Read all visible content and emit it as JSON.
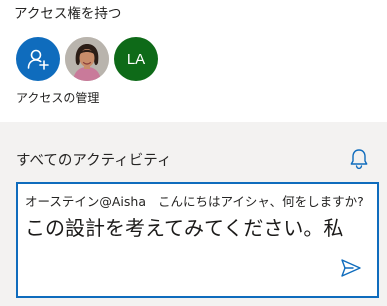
{
  "access": {
    "title": "アクセス権を持つ",
    "add_icon": "add-person-icon",
    "avatar_initials": "LA",
    "manage_label": "アクセスの管理"
  },
  "activity": {
    "title": "すべてのアクティビティ",
    "bell_icon": "bell-icon",
    "comment": {
      "mention_prefix": "オーステイン@Aisha",
      "mention_text": "こんにちはアイシャ、何をしますか?",
      "body_text": "この設計を考えてみてください。私",
      "send_icon": "send-icon"
    }
  },
  "colors": {
    "accent": "#0f6cbd",
    "initials_avatar": "#0e6a18",
    "panel_background": "#f3f2f1"
  }
}
